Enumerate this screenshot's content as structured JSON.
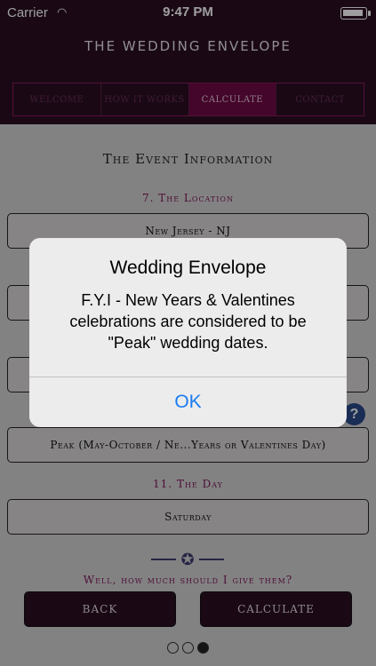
{
  "status_bar": {
    "carrier": "Carrier",
    "wifi_icon": "wifi-icon",
    "time": "9:47 PM"
  },
  "header": {
    "title": "THE WEDDING ENVELOPE"
  },
  "tabs": [
    {
      "label": "WELCOME",
      "active": false
    },
    {
      "label": "HOW IT WORKS",
      "active": false
    },
    {
      "label": "CALCULATE",
      "active": true
    },
    {
      "label": "CONTACT",
      "active": false
    }
  ],
  "content": {
    "section_title": "The Event Information",
    "location_label": "7. The Location",
    "location_value": "New Jersey - NJ",
    "day_type_value": "Peak (May-October / Ne...Years or Valentines Day)",
    "day_label": "11. The Day",
    "day_value": "Saturday",
    "question": "Well, how much should I give them?",
    "help_icon": "?",
    "back_label": "BACK",
    "calculate_label": "CALCULATE",
    "page_dots": {
      "count": 3,
      "active_index": 2
    }
  },
  "alert": {
    "title": "Wedding Envelope",
    "message": "F.Y.I - New Years & Valentines celebrations are considered to be \"Peak\" wedding dates.",
    "ok_label": "OK"
  },
  "colors": {
    "header_bg": "#2a0f22",
    "accent": "#7a1656",
    "ios_blue": "#1b7cf2"
  }
}
